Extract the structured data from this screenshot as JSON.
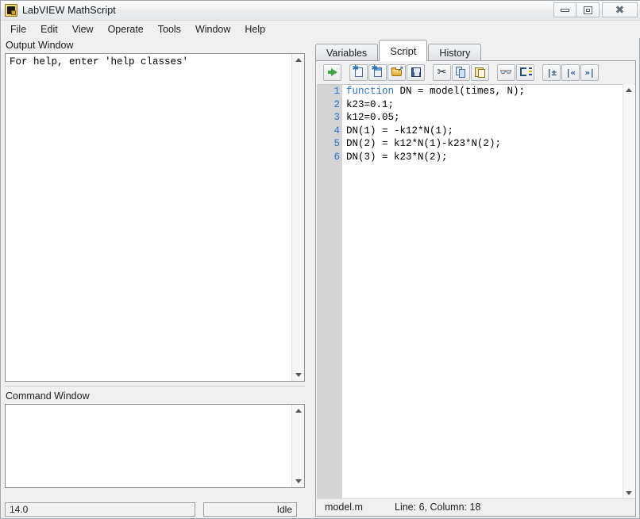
{
  "window": {
    "title": "LabVIEW MathScript",
    "icon": "labview-app-icon",
    "controls": [
      {
        "name": "minimize",
        "glyph": "minimize-icon"
      },
      {
        "name": "restore",
        "glyph": "restore-icon"
      },
      {
        "name": "close",
        "glyph": "close-icon"
      }
    ]
  },
  "menubar": {
    "items": [
      "File",
      "Edit",
      "View",
      "Operate",
      "Tools",
      "Window",
      "Help"
    ]
  },
  "left": {
    "output": {
      "label": "Output Window",
      "text": "For help, enter 'help classes'"
    },
    "command": {
      "label": "Command Window",
      "text": "",
      "placeholder": ""
    },
    "status": {
      "version": "14.0",
      "state": "Idle"
    }
  },
  "right": {
    "tabs": [
      {
        "label": "Variables",
        "active": false
      },
      {
        "label": "Script",
        "active": true
      },
      {
        "label": "History",
        "active": false
      }
    ],
    "toolbar": [
      {
        "name": "run-script-button",
        "icon": "green-right-arrow-icon",
        "title": "Run Script"
      },
      {
        "name": "new-script-button",
        "icon": "new-document-icon",
        "title": "New"
      },
      {
        "name": "new-window-button",
        "icon": "new-window-icon",
        "title": "New Window"
      },
      {
        "name": "open-file-button",
        "icon": "open-folder-icon",
        "title": "Open"
      },
      {
        "name": "save-file-button",
        "icon": "floppy-disk-icon",
        "title": "Save"
      },
      {
        "name": "cut-button",
        "icon": "scissors-icon",
        "title": "Cut"
      },
      {
        "name": "copy-button",
        "icon": "copy-pages-icon",
        "title": "Copy"
      },
      {
        "name": "paste-button",
        "icon": "clipboard-paste-icon",
        "title": "Paste"
      },
      {
        "name": "find-button",
        "icon": "binoculars-icon",
        "title": "Find"
      },
      {
        "name": "goto-line-button",
        "icon": "goto-line-icon",
        "title": "Go To Line"
      },
      {
        "name": "toggle-indent-button",
        "icon": "indent-plusminus-icon",
        "title": "Indent"
      },
      {
        "name": "outdent-button",
        "icon": "outdent-left-icon",
        "title": "Decrease Indent"
      },
      {
        "name": "indent-right-button",
        "icon": "indent-right-icon",
        "title": "Increase Indent"
      }
    ],
    "editor": {
      "lines": [
        {
          "n": "1",
          "keyword": "function",
          "rest": " DN = model(times, N);"
        },
        {
          "n": "2",
          "keyword": "",
          "rest": "k23=0.1;"
        },
        {
          "n": "3",
          "keyword": "",
          "rest": "k12=0.05;"
        },
        {
          "n": "4",
          "keyword": "",
          "rest": "DN(1) = -k12*N(1);"
        },
        {
          "n": "5",
          "keyword": "",
          "rest": "DN(2) = k12*N(1)-k23*N(2);"
        },
        {
          "n": "6",
          "keyword": "",
          "rest": "DN(3) = k23*N(2);"
        }
      ]
    },
    "status": {
      "filename": "model.m",
      "position": "Line: 6, Column: 18"
    }
  },
  "colors": {
    "keyword": "#2f6fd0",
    "line_number": "#2f6fd0",
    "gutter_bg": "#d4d4d4",
    "window_bg": "#f0f0f0",
    "run_arrow": "#3fa93f"
  }
}
